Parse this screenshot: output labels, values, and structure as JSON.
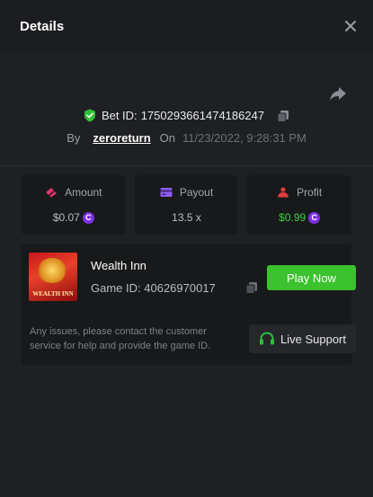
{
  "modal": {
    "title": "Details"
  },
  "bet": {
    "id_label": "Bet ID:",
    "id_value": "1750293661474186247",
    "by_label": "By",
    "username": "zeroreturn",
    "on_label": "On",
    "timestamp": "11/23/2022, 9:28:31 PM"
  },
  "stats": {
    "amount": {
      "label": "Amount",
      "value": "$0.07",
      "icon": "coins-icon",
      "icon_color": "#e0336a"
    },
    "payout": {
      "label": "Payout",
      "value": "13.5 x",
      "icon": "card-icon",
      "icon_color": "#8e5cf0"
    },
    "profit": {
      "label": "Profit",
      "value": "$0.99",
      "icon": "profit-person-icon",
      "icon_color": "#e03b3b",
      "value_color": "#3bd33b"
    }
  },
  "currency_symbol": "C",
  "game": {
    "name": "Wealth Inn",
    "id_label": "Game ID:",
    "id_value": "40626970017",
    "thumbnail_text": "WEALTH INN",
    "play_button": "Play Now"
  },
  "support": {
    "message": "Any issues, please contact the customer service for help and provide the game ID.",
    "button": "Live Support"
  },
  "colors": {
    "accent_green": "#3bc22e",
    "verified_green": "#2fbf3a",
    "coin_purple": "#7f2fe3"
  }
}
